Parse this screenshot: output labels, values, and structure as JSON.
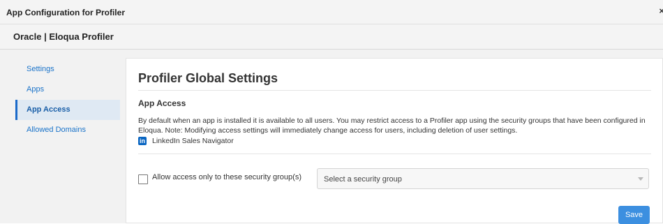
{
  "window": {
    "title": "App Configuration for Profiler",
    "close_glyph": "×"
  },
  "header": {
    "brand": "Oracle | Eloqua Profiler"
  },
  "sidebar": {
    "items": [
      {
        "label": "Settings",
        "active": false
      },
      {
        "label": "Apps",
        "active": false
      },
      {
        "label": "App Access",
        "active": true
      },
      {
        "label": "Allowed Domains",
        "active": false
      }
    ]
  },
  "main": {
    "title": "Profiler Global Settings",
    "section_title": "App Access",
    "description": "By default when an app is installed it is available to all users. You may restrict access to a Profiler app using the security groups that have been configured in Eloqua. Note: Modifying access settings will immediately change access for users, including deletion of user settings.",
    "app": {
      "icon": "linkedin-icon",
      "icon_text": "in",
      "name": "LinkedIn Sales Navigator"
    },
    "restrict": {
      "checkbox_label": "Allow access only to these security group(s)",
      "checked": false,
      "select_placeholder": "Select a security group"
    },
    "save_label": "Save"
  },
  "colors": {
    "accent": "#3c8fe0",
    "link": "#1a73c9",
    "linkedin": "#0a66c2",
    "active_nav_bg": "#dfe9f3"
  }
}
